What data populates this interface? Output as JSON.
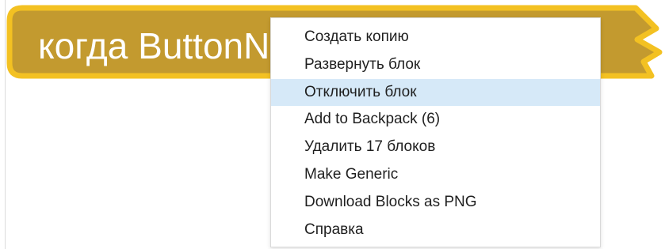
{
  "block": {
    "label": "когда ButtonN",
    "fill_color": "#c39a2f",
    "outline_color": "#f3c122"
  },
  "context_menu": {
    "highlight_color": "#d6e9f8",
    "items": [
      {
        "label": "Создать копию",
        "highlighted": false
      },
      {
        "label": "Развернуть блок",
        "highlighted": false
      },
      {
        "label": "Отключить блок",
        "highlighted": true
      },
      {
        "label": "Add to Backpack (6)",
        "highlighted": false
      },
      {
        "label": "Удалить 17 блоков",
        "highlighted": false
      },
      {
        "label": "Make Generic",
        "highlighted": false
      },
      {
        "label": "Download Blocks as PNG",
        "highlighted": false
      },
      {
        "label": "Справка",
        "highlighted": false
      }
    ]
  }
}
